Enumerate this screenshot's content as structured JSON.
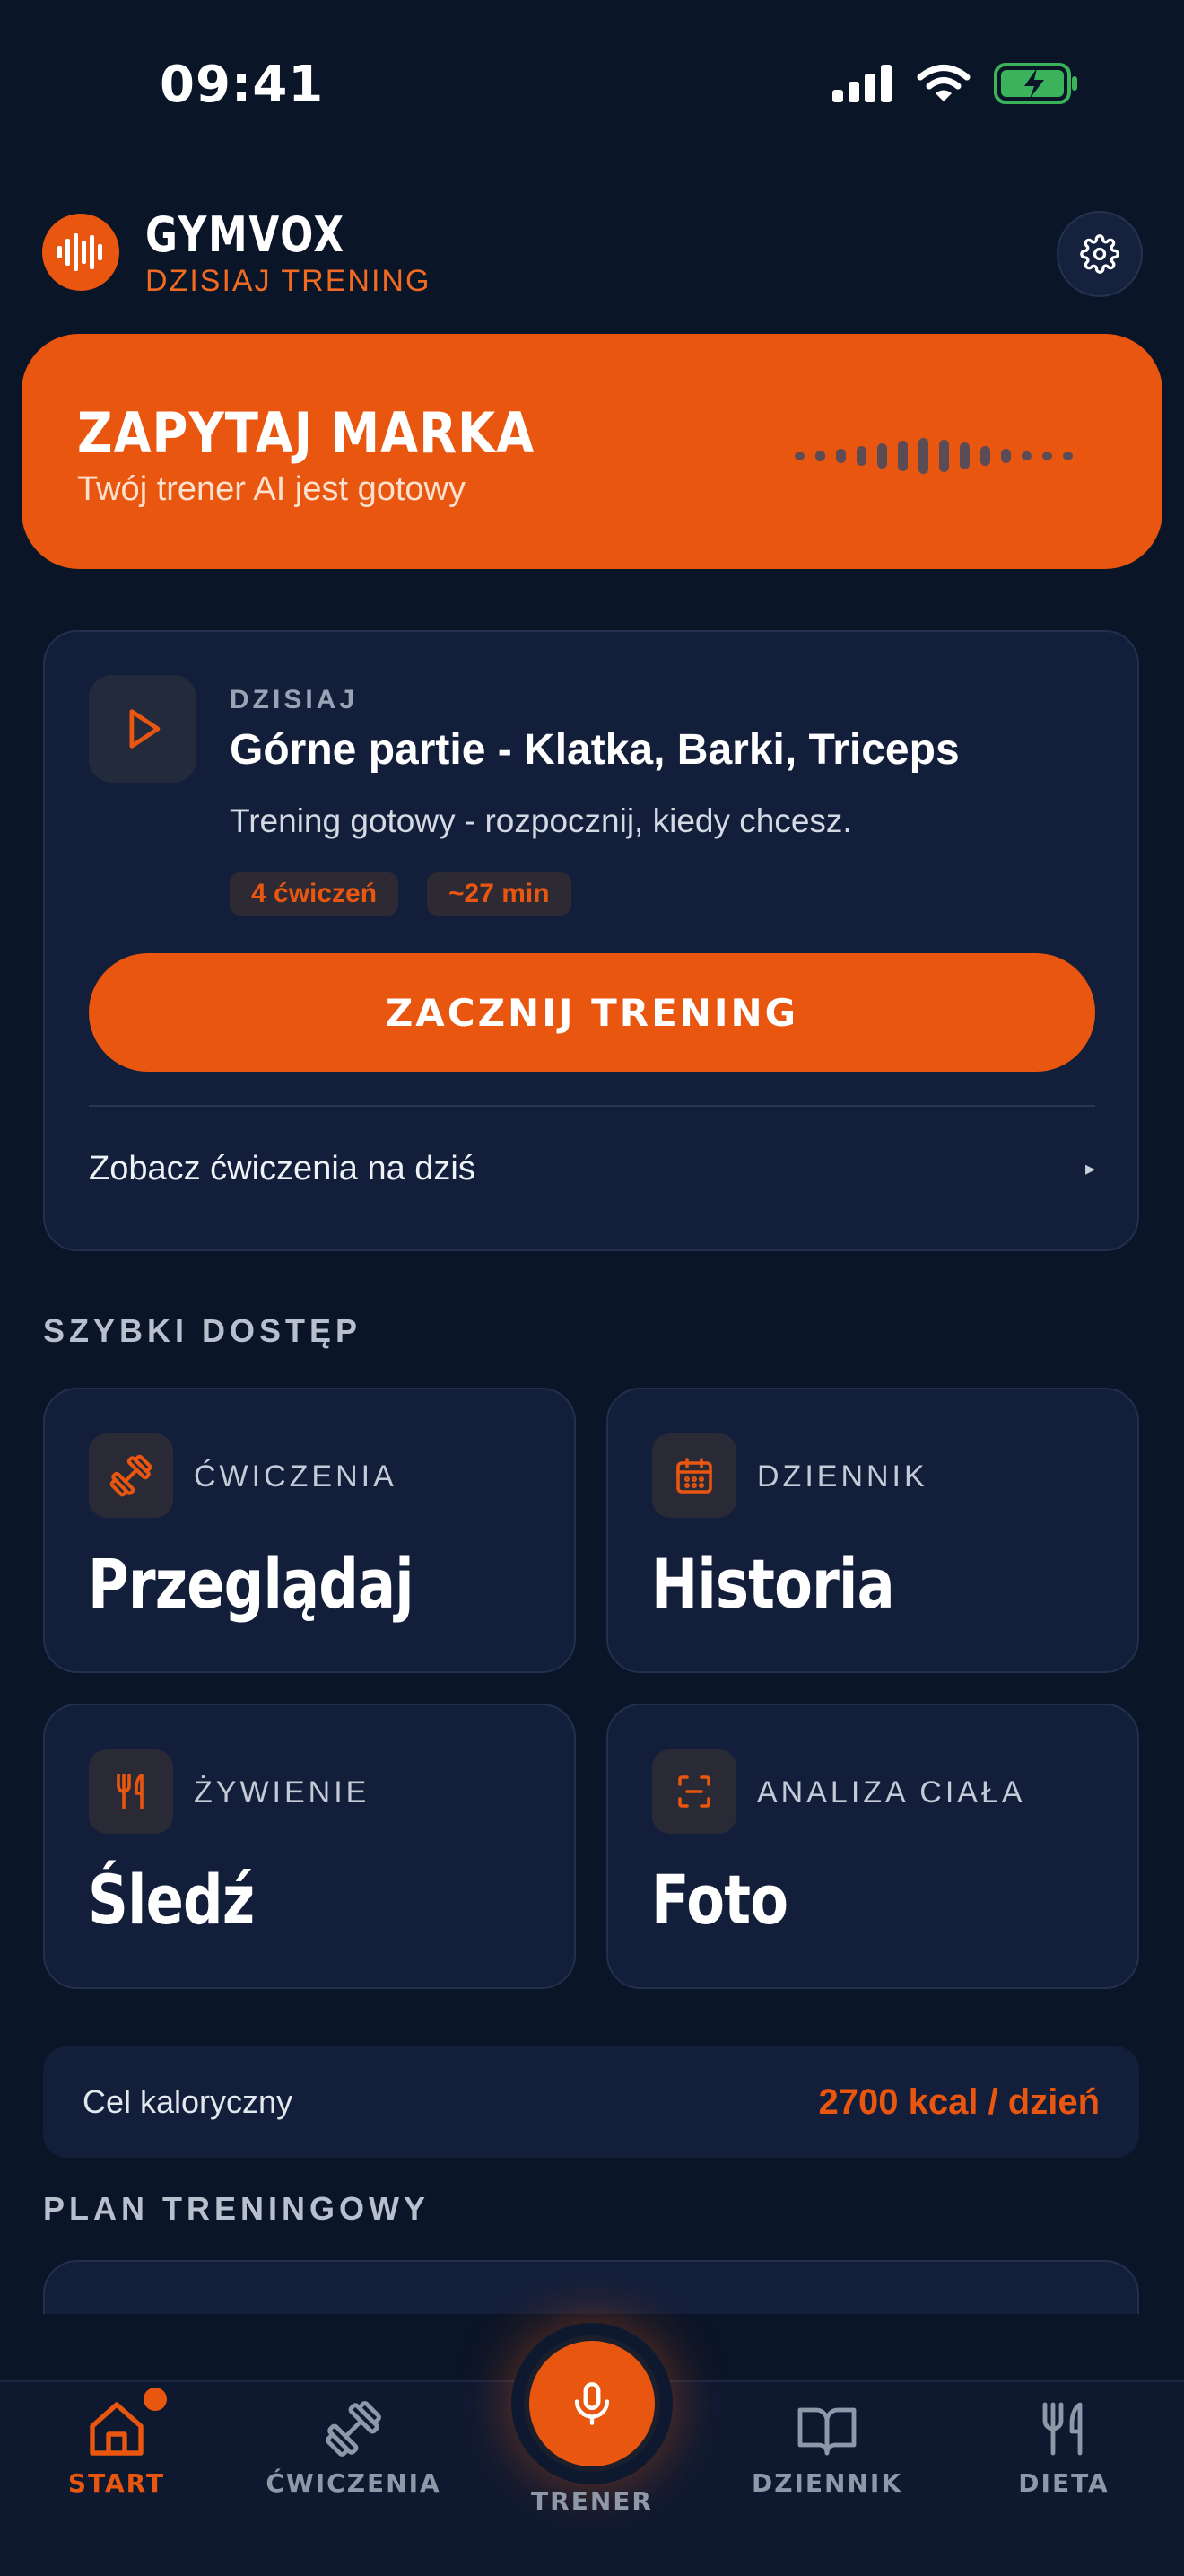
{
  "status_bar": {
    "time": "09:41"
  },
  "header": {
    "brand": "GYMVOX",
    "subtitle": "DZISIAJ TRENING"
  },
  "hero": {
    "title": "ZAPYTAJ MARKA",
    "subtitle": "Twój trener AI jest gotowy"
  },
  "today": {
    "label": "DZISIAJ",
    "title": "Górne partie - Klatka, Barki, Triceps",
    "description": "Trening gotowy - rozpocznij, kiedy chcesz.",
    "tags": [
      "4 ćwiczeń",
      "~27 min"
    ],
    "start_button": "ZACZNIJ TRENING",
    "see_link": "Zobacz ćwiczenia na dziś"
  },
  "quick_access": {
    "title": "SZYBKI DOSTĘP",
    "tiles": [
      {
        "label": "ĆWICZENIA",
        "value": "Przeglądaj",
        "icon": "dumbbell-icon"
      },
      {
        "label": "DZIENNIK",
        "value": "Historia",
        "icon": "calendar-icon"
      },
      {
        "label": "ŻYWIENIE",
        "value": "Śledź",
        "icon": "fork-knife-icon"
      },
      {
        "label": "ANALIZA CIAŁA",
        "value": "Foto",
        "icon": "scan-icon"
      }
    ]
  },
  "calorie": {
    "label": "Cel kaloryczny",
    "value": "2700 kcal / dzień"
  },
  "plan": {
    "title": "PLAN TRENINGOWY"
  },
  "nav": {
    "items": [
      {
        "label": "START",
        "active": true
      },
      {
        "label": "ĆWICZENIA"
      },
      {
        "label": "TRENER"
      },
      {
        "label": "DZIENNIK"
      },
      {
        "label": "DIETA"
      }
    ]
  },
  "colors": {
    "accent": "#e8560f",
    "background": "#0b1528",
    "card": "#131f3a"
  }
}
